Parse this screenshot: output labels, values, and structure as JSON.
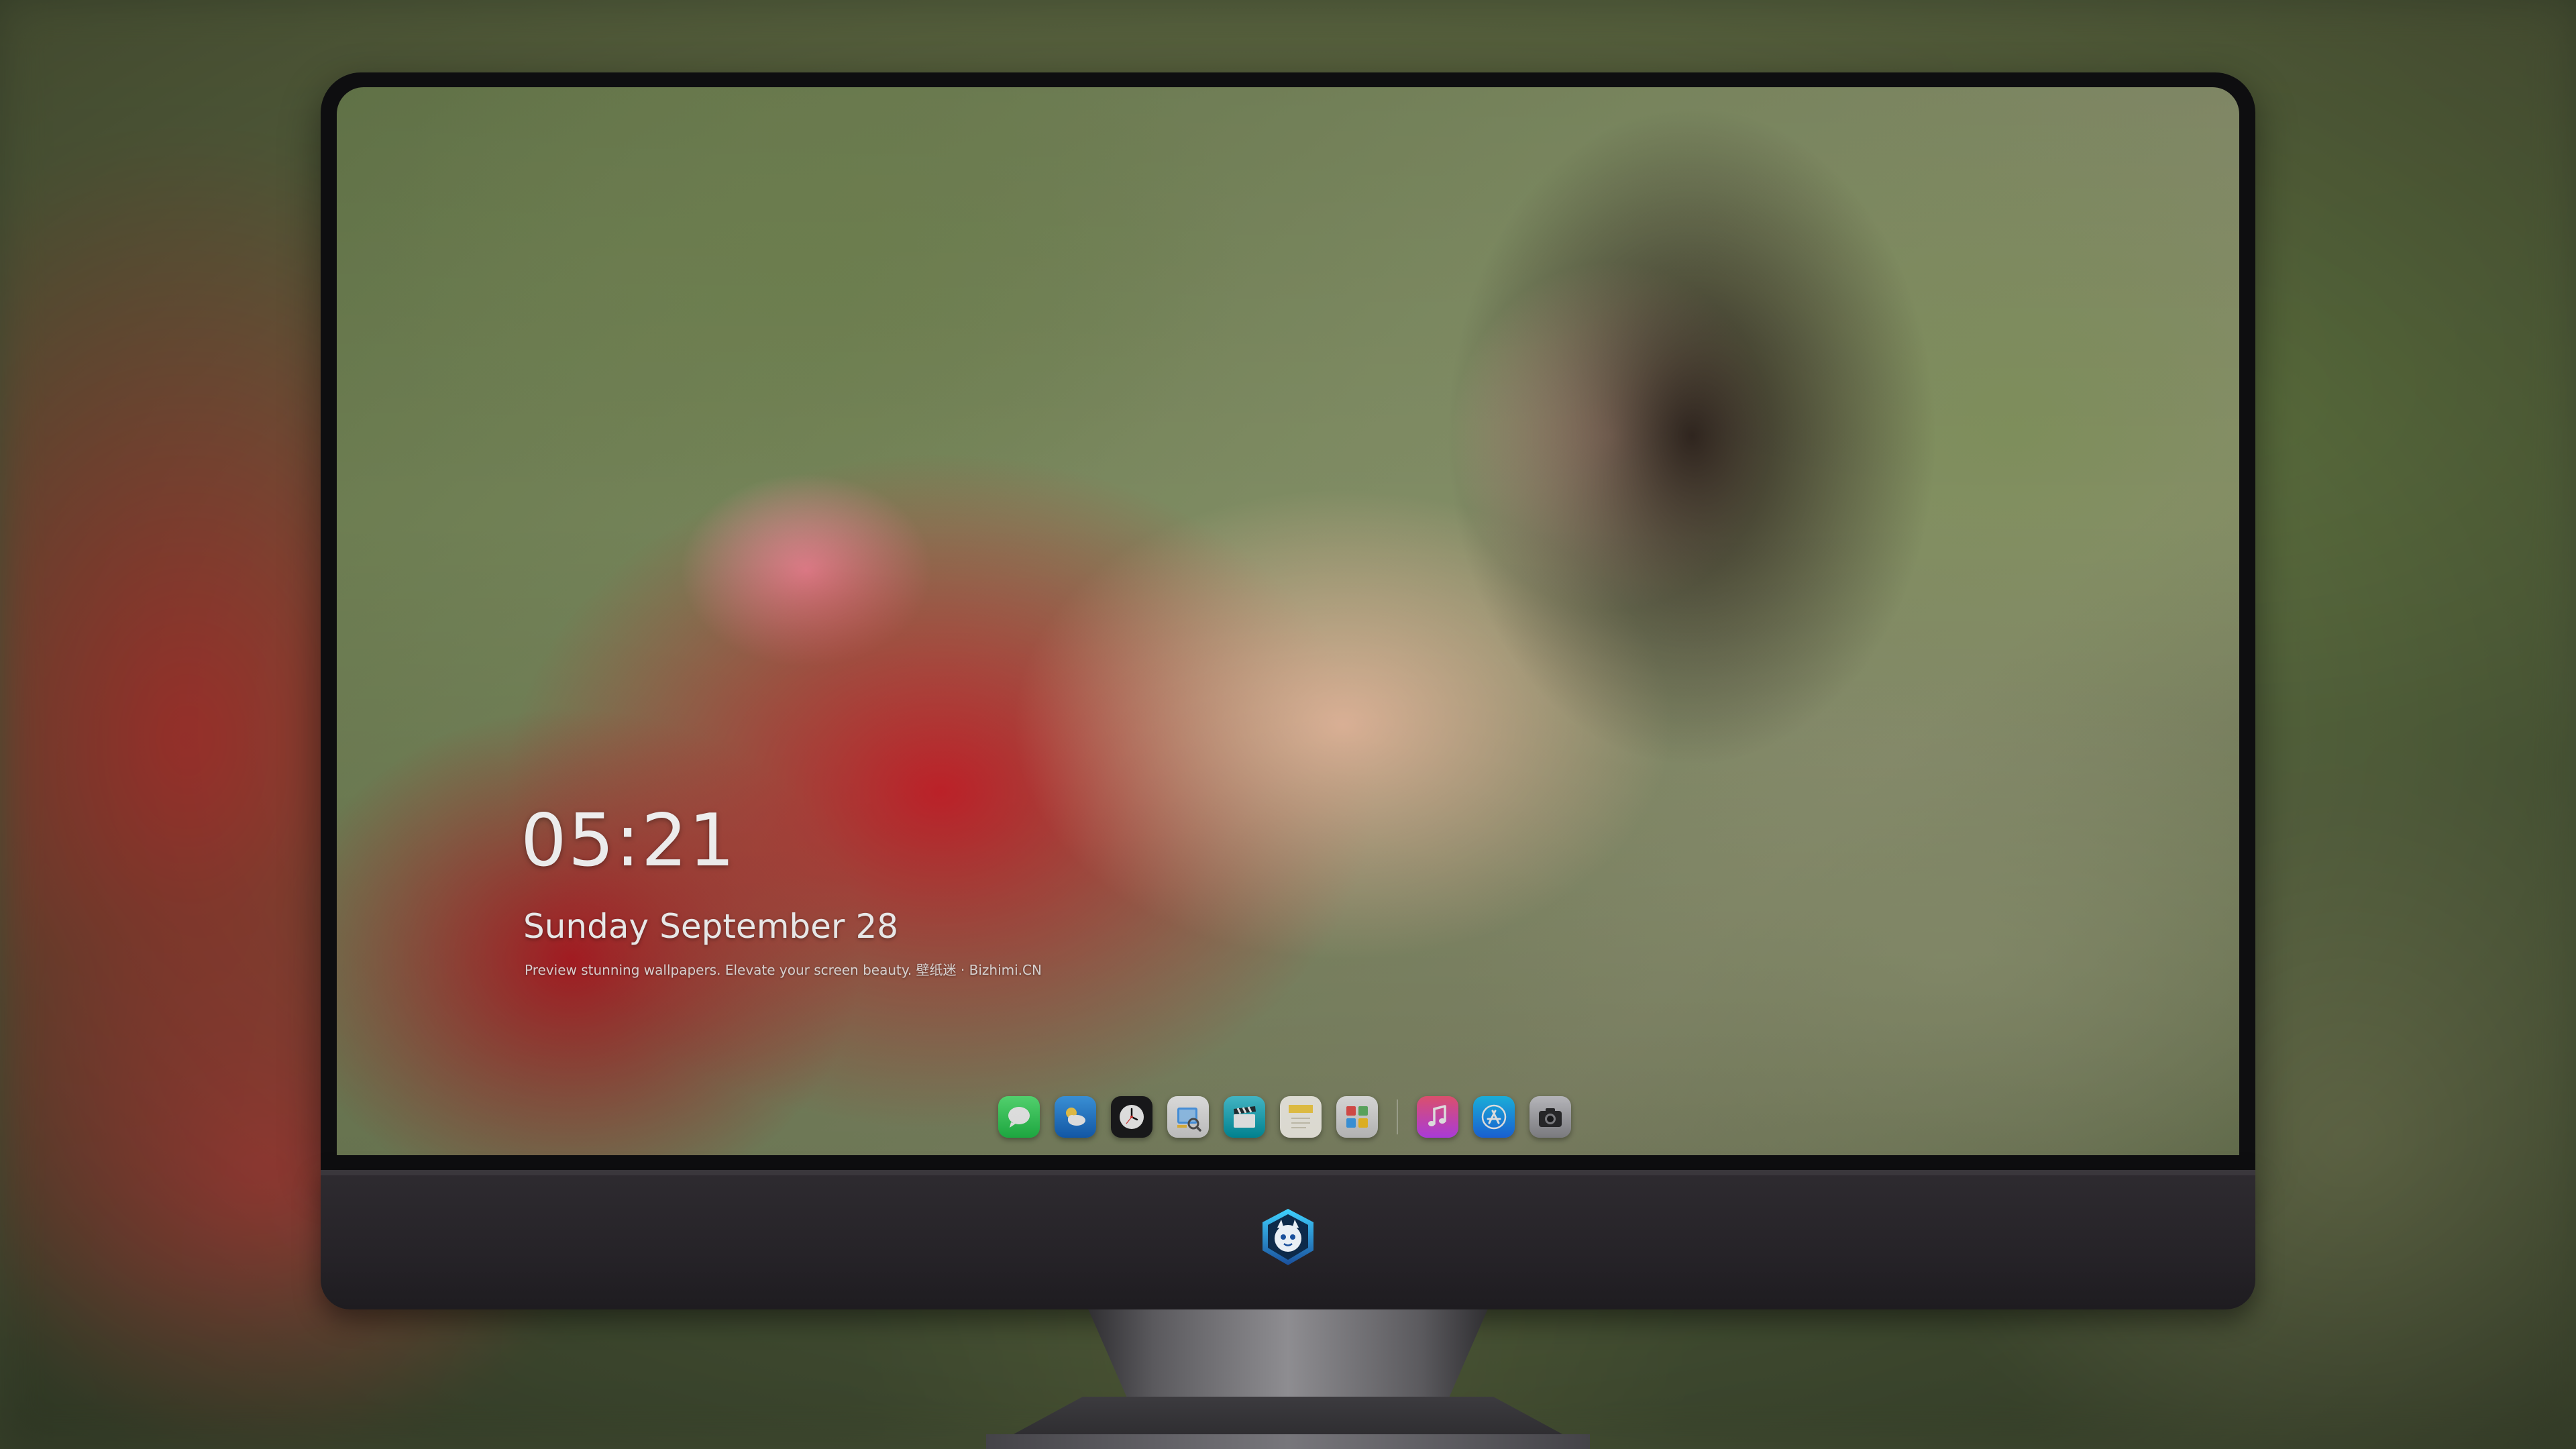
{
  "lockscreen": {
    "time": "05:21",
    "date_weekday": "Sunday",
    "date_month": "September",
    "date_day": "28",
    "tagline": "Preview stunning wallpapers. Elevate your screen beauty. 壁纸迷 · Bizhimi.CN"
  },
  "dock": {
    "apps": [
      {
        "name": "Messages",
        "icon": "messages-icon",
        "color": "#2fd158"
      },
      {
        "name": "Weather",
        "icon": "weather-icon",
        "color": "#1e88e5"
      },
      {
        "name": "Clock",
        "icon": "clock-icon",
        "color": "#ffffff"
      },
      {
        "name": "Preview",
        "icon": "preview-icon",
        "color": "#f5c542"
      },
      {
        "name": "Clips",
        "icon": "clips-icon",
        "color": "#26c6da"
      },
      {
        "name": "Notes",
        "icon": "notes-icon",
        "color": "#ffd84d"
      },
      {
        "name": "Photo Gallery",
        "icon": "gallery-icon",
        "color": "#eaeaea"
      },
      {
        "name": "Music",
        "icon": "music-icon",
        "color": "#fc3c8c"
      },
      {
        "name": "App Store",
        "icon": "app-store-icon",
        "color": "#1d8df5"
      },
      {
        "name": "Camera",
        "icon": "camera-icon",
        "color": "#8e8e93"
      }
    ]
  },
  "monitor": {
    "logo_icon": "mascot-logo-icon",
    "bezel_color": "#0e0e10",
    "chin_color": "#2a272c"
  }
}
